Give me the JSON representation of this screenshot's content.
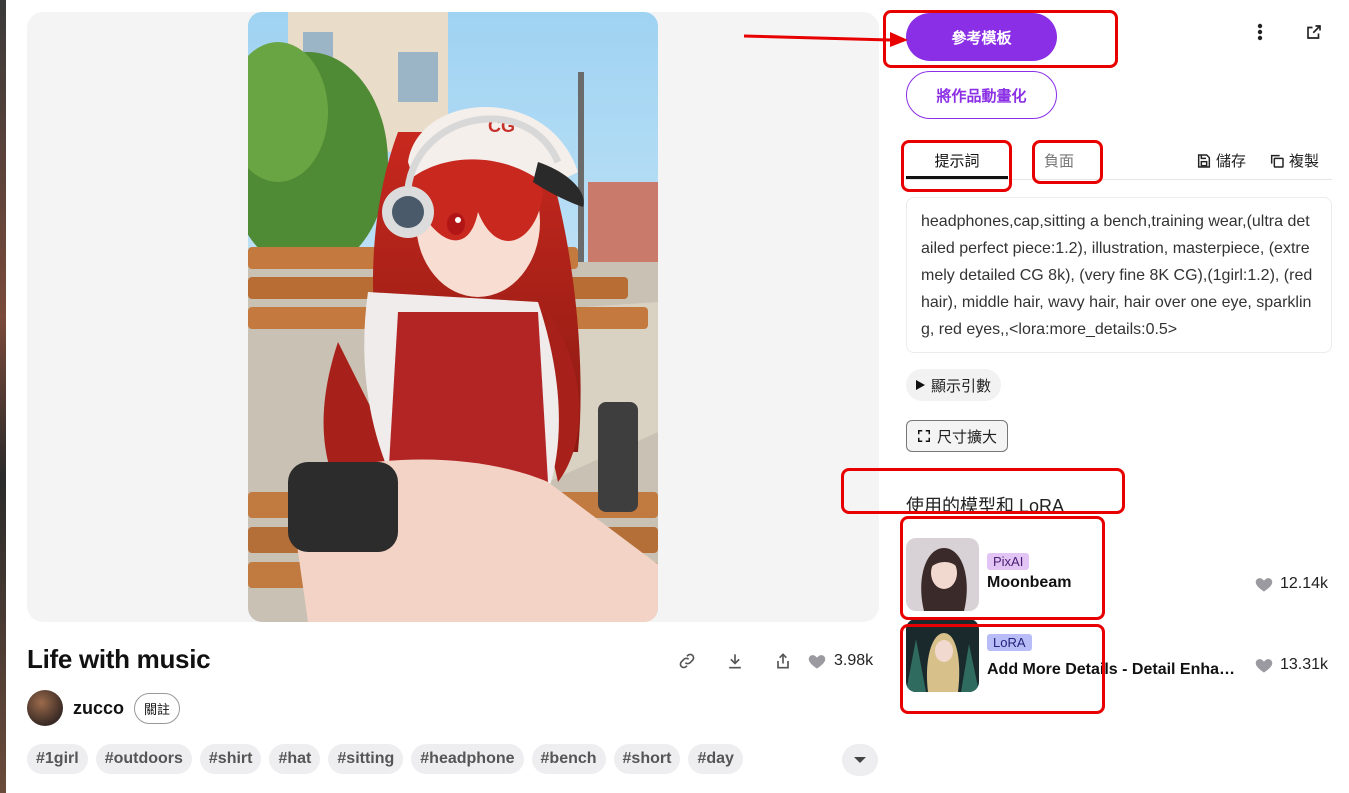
{
  "artwork": {
    "title": "Life with music",
    "likes": "3.98k",
    "author": "zucco",
    "follow_label": "關註",
    "cap_text": "CG",
    "tags": [
      "#1girl",
      "#outdoors",
      "#shirt",
      "#hat",
      "#sitting",
      "#headphone",
      "#bench",
      "#short",
      "#day"
    ]
  },
  "actions": {
    "reference_template_label": "參考模板",
    "animate_label": "將作品動畫化"
  },
  "tabs": {
    "prompt_label": "提示詞",
    "negative_label": "負面",
    "save_label": "儲存",
    "copy_label": "複製"
  },
  "prompt_text": "headphones,cap,sitting a bench,training wear,(ultra detailed perfect piece:1.2), illustration, masterpiece, (extremely detailed CG 8k), (very fine 8K CG),(1girl:1.2), (red hair), middle hair, wavy hair, hair over one eye, sparkling, red eyes,,<lora:more_details:0.5>",
  "show_params_label": "顯示引數",
  "upscale_label": "尺寸擴大",
  "models_section_title": "使用的模型和 LoRA",
  "models": [
    {
      "badge": "PixAI",
      "name": "Moonbeam",
      "likes": "12.14k",
      "badge_bg": "#e2c4f5",
      "badge_color": "#4a1d70"
    },
    {
      "badge": "LoRA",
      "name": "Add More Details - Detail Enhancer / Tweaker (細節調整) LoRA",
      "likes": "13.31k",
      "badge_bg": "#b9bdf7",
      "badge_color": "#1f237a"
    }
  ],
  "colors": {
    "accent": "#8b2fe6",
    "annotation": "#e80000"
  }
}
